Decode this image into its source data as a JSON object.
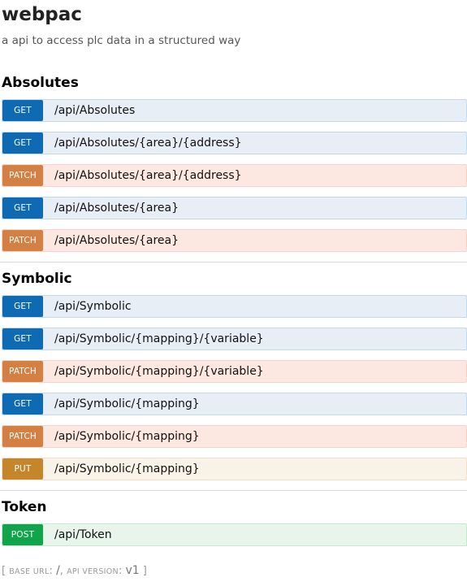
{
  "app": {
    "title": "webpac",
    "description": "a api to access plc data in a structured way"
  },
  "sections": [
    {
      "name": "Absolutes",
      "operations": [
        {
          "method": "GET",
          "path": "/api/Absolutes"
        },
        {
          "method": "GET",
          "path": "/api/Absolutes/{area}/{address}"
        },
        {
          "method": "PATCH",
          "path": "/api/Absolutes/{area}/{address}"
        },
        {
          "method": "GET",
          "path": "/api/Absolutes/{area}"
        },
        {
          "method": "PATCH",
          "path": "/api/Absolutes/{area}"
        }
      ]
    },
    {
      "name": "Symbolic",
      "operations": [
        {
          "method": "GET",
          "path": "/api/Symbolic"
        },
        {
          "method": "GET",
          "path": "/api/Symbolic/{mapping}/{variable}"
        },
        {
          "method": "PATCH",
          "path": "/api/Symbolic/{mapping}/{variable}"
        },
        {
          "method": "GET",
          "path": "/api/Symbolic/{mapping}"
        },
        {
          "method": "PATCH",
          "path": "/api/Symbolic/{mapping}"
        },
        {
          "method": "PUT",
          "path": "/api/Symbolic/{mapping}"
        }
      ]
    },
    {
      "name": "Token",
      "operations": [
        {
          "method": "POST",
          "path": "/api/Token"
        }
      ]
    }
  ],
  "footer": {
    "open_bracket": "[",
    "base_url_label": "BASE URL",
    "base_url_value": "/",
    "separator": ",",
    "api_version_label": "API VERSION",
    "api_version_value": "v1",
    "close_bracket": "]"
  },
  "colors": {
    "GET": "#0f6ab4",
    "PATCH": "#d38042",
    "PUT": "#c5862b",
    "POST": "#10a54a"
  }
}
